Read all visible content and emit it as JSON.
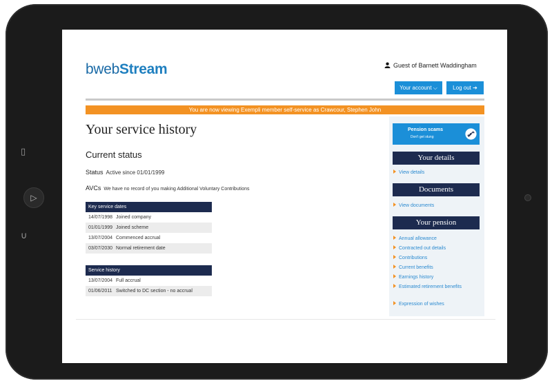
{
  "logo": {
    "part1": "bweb",
    "part2": "Stream"
  },
  "header": {
    "guest_text": "Guest of Barnett Waddingham",
    "account_button": "Your account",
    "logout_button": "Log out"
  },
  "banner": "You are now viewing Exempli member self-service as Crawcour, Stephen John",
  "page_title": "Your service history",
  "current_status": {
    "heading": "Current status",
    "status_label": "Status",
    "status_value": "Active since 01/01/1999",
    "avcs_label": "AVCs",
    "avcs_value": "We have no record of you making Additional Voluntary Contributions"
  },
  "key_dates": {
    "heading": "Key service dates",
    "rows": [
      {
        "date": "14/07/1998",
        "event": "Joined company"
      },
      {
        "date": "01/01/1999",
        "event": "Joined scheme"
      },
      {
        "date": "13/07/2004",
        "event": "Commenced accrual"
      },
      {
        "date": "03/07/2030",
        "event": "Normal retirement date"
      }
    ]
  },
  "service_history": {
    "heading": "Service history",
    "rows": [
      {
        "date": "13/07/2004",
        "event": "Full accrual"
      },
      {
        "date": "01/06/2011",
        "event": "Switched to DC section - no accrual"
      }
    ]
  },
  "sidebar": {
    "scam_title": "Pension scams",
    "scam_sub": "Don't get stung",
    "your_details": "Your details",
    "view_details": "View details",
    "documents": "Documents",
    "view_documents": "View documents",
    "your_pension": "Your pension",
    "pension_links": [
      "Annual allowance",
      "Contracted out details",
      "Contributions",
      "Current benefits",
      "Earnings history",
      "Estimated retirement benefits",
      "Expression of wishes"
    ]
  },
  "colors": {
    "accent_blue": "#1b8fd8",
    "navy": "#1d2b4f",
    "orange": "#f39223"
  }
}
